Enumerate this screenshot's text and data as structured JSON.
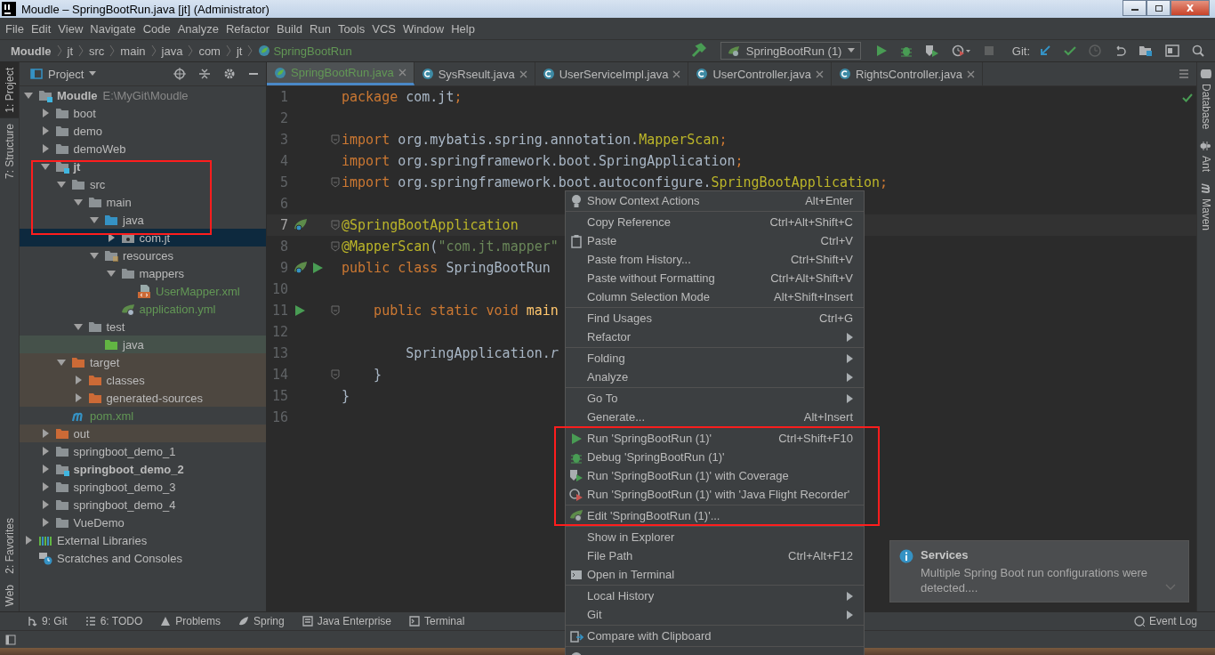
{
  "window": {
    "title": "Moudle – SpringBootRun.java [jt] (Administrator)"
  },
  "menu_bar": [
    "File",
    "Edit",
    "View",
    "Navigate",
    "Code",
    "Analyze",
    "Refactor",
    "Build",
    "Run",
    "Tools",
    "VCS",
    "Window",
    "Help"
  ],
  "breadcrumbs": [
    {
      "label": "Moudle",
      "kind": "module"
    },
    {
      "label": "jt",
      "kind": "module"
    },
    {
      "label": "src",
      "kind": "folder"
    },
    {
      "label": "main",
      "kind": "folder"
    },
    {
      "label": "java",
      "kind": "folder"
    },
    {
      "label": "com",
      "kind": "folder"
    },
    {
      "label": "jt",
      "kind": "folder"
    },
    {
      "label": "SpringBootRun",
      "kind": "class"
    }
  ],
  "toolbar": {
    "run_config": "SpringBootRun (1)",
    "git_label": "Git:"
  },
  "left_strip": {
    "top": [
      {
        "label": "1: Project",
        "selected": true
      },
      {
        "label": "7: Structure",
        "selected": false
      }
    ],
    "bottom": [
      {
        "label": "2: Favorites",
        "selected": false
      },
      {
        "label": "Web",
        "selected": false
      }
    ]
  },
  "right_strip": [
    {
      "label": "Database",
      "kind": "database"
    },
    {
      "label": "Ant",
      "kind": "ant"
    },
    {
      "label": "Maven",
      "kind": "maven"
    }
  ],
  "project_panel": {
    "title": "Project"
  },
  "tree": [
    {
      "name": "Moudle",
      "hint": "E:\\MyGit\\Moudle",
      "kind": "module",
      "expanded": true,
      "selected": false,
      "children": [
        {
          "name": "boot",
          "kind": "folder",
          "expanded": false,
          "selected": false
        },
        {
          "name": "demo",
          "kind": "folder",
          "expanded": false,
          "selected": false
        },
        {
          "name": "demoWeb",
          "kind": "folder",
          "expanded": false,
          "selected": false
        },
        {
          "name": "jt",
          "kind": "module",
          "expanded": true,
          "selected": false,
          "children": [
            {
              "name": "src",
              "kind": "folder",
              "expanded": true,
              "selected": false,
              "children": [
                {
                  "name": "main",
                  "kind": "folder",
                  "expanded": true,
                  "selected": false,
                  "children": [
                    {
                      "name": "java",
                      "kind": "source",
                      "expanded": true,
                      "selected": false,
                      "children": [
                        {
                          "name": "com.jt",
                          "kind": "package",
                          "expanded": false,
                          "selected": true
                        }
                      ]
                    },
                    {
                      "name": "resources",
                      "kind": "resources",
                      "expanded": true,
                      "selected": false,
                      "children": [
                        {
                          "name": "mappers",
                          "kind": "folder",
                          "expanded": true,
                          "selected": false,
                          "children": [
                            {
                              "name": "UserMapper.xml",
                              "kind": "xml",
                              "added": true,
                              "selected": false
                            }
                          ]
                        },
                        {
                          "name": "application.yml",
                          "kind": "spring-config",
                          "added": true,
                          "selected": false
                        }
                      ]
                    }
                  ]
                },
                {
                  "name": "test",
                  "kind": "folder",
                  "expanded": true,
                  "selected": false,
                  "children": [
                    {
                      "name": "java",
                      "kind": "test-source",
                      "selected": false
                    }
                  ]
                }
              ]
            },
            {
              "name": "target",
              "kind": "excluded",
              "expanded": true,
              "selected": false,
              "children": [
                {
                  "name": "classes",
                  "kind": "excluded",
                  "expanded": false,
                  "selected": false
                },
                {
                  "name": "generated-sources",
                  "kind": "excluded",
                  "expanded": false,
                  "selected": false
                }
              ]
            },
            {
              "name": "pom.xml",
              "kind": "maven",
              "added": true,
              "selected": false
            }
          ]
        },
        {
          "name": "out",
          "kind": "excluded",
          "expanded": false,
          "selected": false
        },
        {
          "name": "springboot_demo_1",
          "kind": "folder",
          "expanded": false,
          "selected": false
        },
        {
          "name": "springboot_demo_2",
          "kind": "module",
          "expanded": false,
          "selected": false
        },
        {
          "name": "springboot_demo_3",
          "kind": "folder",
          "expanded": false,
          "selected": false
        },
        {
          "name": "springboot_demo_4",
          "kind": "folder",
          "expanded": false,
          "selected": false
        },
        {
          "name": "VueDemo",
          "kind": "folder",
          "expanded": false,
          "selected": false
        }
      ]
    },
    {
      "name": "External Libraries",
      "kind": "libraries",
      "expanded": false,
      "selected": false
    },
    {
      "name": "Scratches and Consoles",
      "kind": "scratches",
      "selected": false
    }
  ],
  "tabs": [
    {
      "label": "SpringBootRun.java",
      "selected": true,
      "kind": "spring"
    },
    {
      "label": "SysRseult.java",
      "selected": false,
      "kind": "class"
    },
    {
      "label": "UserServiceImpl.java",
      "selected": false,
      "kind": "class"
    },
    {
      "label": "UserController.java",
      "selected": false,
      "kind": "class"
    },
    {
      "label": "RightsController.java",
      "selected": false,
      "kind": "class"
    }
  ],
  "code": [
    {
      "number": "1",
      "current": false,
      "fold": false,
      "tokens": [
        {
          "t": "package ",
          "kind": "kw"
        },
        {
          "t": "com.jt",
          "kind": "plain"
        },
        {
          "t": ";",
          "kind": "kw"
        }
      ]
    },
    {
      "number": "2",
      "current": false,
      "fold": false
    },
    {
      "number": "3",
      "current": false,
      "fold": true,
      "tokens": [
        {
          "t": "import ",
          "kind": "kw"
        },
        {
          "t": "org.mybatis.spring.annotation.",
          "kind": "plain"
        },
        {
          "t": "MapperScan",
          "kind": "anno"
        },
        {
          "t": ";",
          "kind": "kw"
        }
      ]
    },
    {
      "number": "4",
      "current": false,
      "fold": false,
      "tokens": [
        {
          "t": "import ",
          "kind": "kw"
        },
        {
          "t": "org.springframework.boot.SpringApplication",
          "kind": "plain"
        },
        {
          "t": ";",
          "kind": "kw"
        }
      ]
    },
    {
      "number": "5",
      "current": false,
      "fold": true,
      "tokens": [
        {
          "t": "import ",
          "kind": "kw"
        },
        {
          "t": "org.springframework.boot.autoconfigure.",
          "kind": "plain"
        },
        {
          "t": "SpringBootApplication",
          "kind": "anno"
        },
        {
          "t": ";",
          "kind": "kw"
        }
      ]
    },
    {
      "number": "6",
      "current": false,
      "fold": false
    },
    {
      "number": "7",
      "current": true,
      "fold": true,
      "bean": true,
      "tokens": [
        {
          "t": "@SpringBootApplication",
          "kind": "anno"
        }
      ]
    },
    {
      "number": "8",
      "current": false,
      "fold": true,
      "tokens": [
        {
          "t": "@MapperScan",
          "kind": "anno"
        },
        {
          "t": "(",
          "kind": "plain"
        },
        {
          "t": "\"com.jt.mapper\"",
          "kind": "str"
        }
      ]
    },
    {
      "number": "9",
      "current": false,
      "fold": false,
      "bean": true,
      "run": true,
      "tokens": [
        {
          "t": "public class ",
          "kind": "kw"
        },
        {
          "t": "SpringBootRun",
          "kind": "plain"
        }
      ]
    },
    {
      "number": "10",
      "current": false,
      "fold": false
    },
    {
      "number": "11",
      "current": false,
      "fold": true,
      "run": true,
      "tokens": [
        {
          "t": "    public static void ",
          "kind": "kw"
        },
        {
          "t": "main",
          "kind": "method"
        }
      ]
    },
    {
      "number": "12",
      "current": false,
      "fold": false
    },
    {
      "number": "13",
      "current": false,
      "fold": false,
      "tokens": [
        {
          "t": "        SpringApplication.",
          "kind": "plain"
        },
        {
          "t": "r",
          "kind": "italic"
        }
      ]
    },
    {
      "number": "14",
      "current": false,
      "fold": true,
      "tokens": [
        {
          "t": "    }",
          "kind": "plain"
        }
      ]
    },
    {
      "number": "15",
      "current": false,
      "fold": false,
      "tokens": [
        {
          "t": "}",
          "kind": "plain"
        }
      ]
    },
    {
      "number": "16",
      "current": false,
      "fold": false
    }
  ],
  "context_menu": [
    [
      {
        "label": "Show Context Actions",
        "shortcut": "Alt+Enter",
        "kind": "bulb",
        "submenu": false
      }
    ],
    [
      {
        "label": "Copy Reference",
        "shortcut": "Ctrl+Alt+Shift+C",
        "submenu": false
      },
      {
        "label": "Paste",
        "shortcut": "Ctrl+V",
        "kind": "clipboard",
        "submenu": false
      },
      {
        "label": "Paste from History...",
        "shortcut": "Ctrl+Shift+V",
        "submenu": false
      },
      {
        "label": "Paste without Formatting",
        "shortcut": "Ctrl+Alt+Shift+V",
        "submenu": false
      },
      {
        "label": "Column Selection Mode",
        "shortcut": "Alt+Shift+Insert",
        "submenu": false
      }
    ],
    [
      {
        "label": "Find Usages",
        "shortcut": "Ctrl+G",
        "submenu": false
      },
      {
        "label": "Refactor",
        "submenu": true
      }
    ],
    [
      {
        "label": "Folding",
        "submenu": true
      },
      {
        "label": "Analyze",
        "submenu": true
      }
    ],
    [
      {
        "label": "Go To",
        "submenu": true
      },
      {
        "label": "Generate...",
        "shortcut": "Alt+Insert",
        "submenu": false
      }
    ],
    [
      {
        "label": "Run 'SpringBootRun (1)'",
        "shortcut": "Ctrl+Shift+F10",
        "kind": "run",
        "submenu": false
      },
      {
        "label": "Debug 'SpringBootRun (1)'",
        "kind": "debug",
        "submenu": false
      },
      {
        "label": "Run 'SpringBootRun (1)' with Coverage",
        "kind": "coverage",
        "submenu": false
      },
      {
        "label": "Run 'SpringBootRun (1)' with 'Java Flight Recorder'",
        "kind": "profiler",
        "submenu": false
      }
    ],
    [
      {
        "label": "Edit 'SpringBootRun (1)'...",
        "kind": "edit-config",
        "submenu": false
      }
    ],
    [
      {
        "label": "Show in Explorer",
        "submenu": false
      },
      {
        "label": "File Path",
        "shortcut": "Ctrl+Alt+F12",
        "submenu": false
      },
      {
        "label": "Open in Terminal",
        "kind": "terminal",
        "submenu": false
      }
    ],
    [
      {
        "label": "Local History",
        "submenu": true
      },
      {
        "label": "Git",
        "submenu": true
      }
    ],
    [
      {
        "label": "Compare with Clipboard",
        "kind": "compare",
        "submenu": false
      }
    ],
    [
      {
        "kind": "github",
        "submenu": false
      }
    ]
  ],
  "notification": {
    "title": "Services",
    "message": "Multiple Spring Boot run configurations were detected...."
  },
  "bottom_tools": [
    {
      "label": "9: Git",
      "kind": "git"
    },
    {
      "label": "6: TODO",
      "kind": "todo"
    },
    {
      "label": "Problems",
      "kind": "warning"
    },
    {
      "label": "Spring",
      "kind": "spring"
    },
    {
      "label": "Java Enterprise",
      "kind": "enterprise"
    },
    {
      "label": "Terminal",
      "kind": "terminal"
    }
  ],
  "event_log": "Event Log"
}
